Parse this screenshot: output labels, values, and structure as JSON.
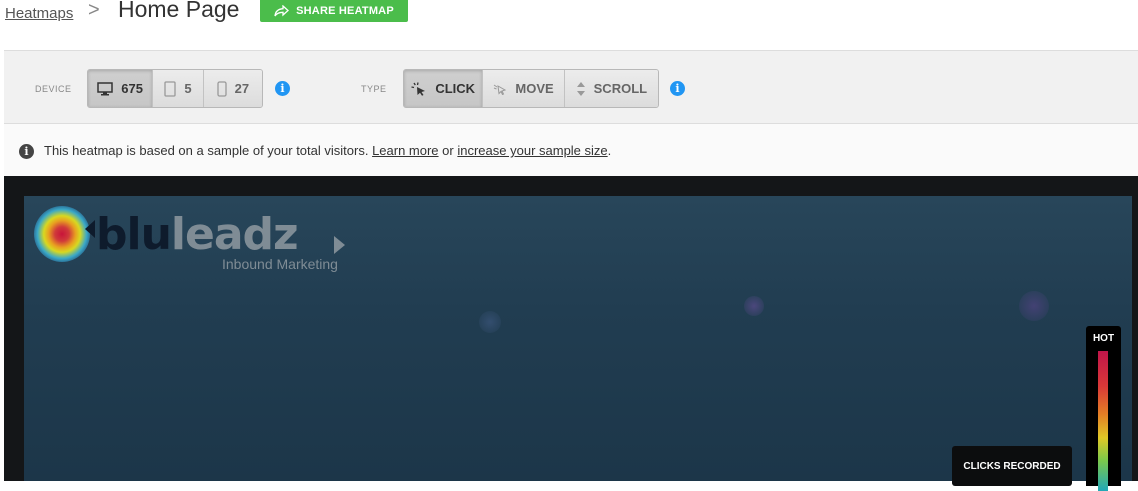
{
  "header": {
    "breadcrumb": "Heatmaps",
    "separator": ">",
    "title": "Home Page",
    "share_label": "SHARE HEATMAP"
  },
  "toolbar": {
    "device_label": "DEVICE",
    "devices": [
      {
        "icon": "desktop-icon",
        "count": "675",
        "active": true
      },
      {
        "icon": "tablet-icon",
        "count": "5",
        "active": false
      },
      {
        "icon": "phone-icon",
        "count": "27",
        "active": false
      }
    ],
    "type_label": "TYPE",
    "types": [
      {
        "icon": "click-icon",
        "label": "CLICK",
        "active": true
      },
      {
        "icon": "move-icon",
        "label": "MOVE",
        "active": false
      },
      {
        "icon": "scroll-icon",
        "label": "SCROLL",
        "active": false
      }
    ],
    "info_glyph": "i"
  },
  "notice": {
    "text_before": "This heatmap is based on a sample of your total visitors.",
    "learn_more": "Learn more",
    "or": "or",
    "increase_link": "increase your sample size",
    "period": "."
  },
  "heatmap": {
    "logo_part1": "blu",
    "logo_part2": "leadz",
    "tagline": "Inbound Marketing",
    "legend_label": "HOT",
    "clicks_label": "CLICKS RECORDED"
  },
  "colors": {
    "share_green": "#4bbd4b",
    "info_blue": "#2196f3",
    "heat_bg": "#213d51"
  }
}
